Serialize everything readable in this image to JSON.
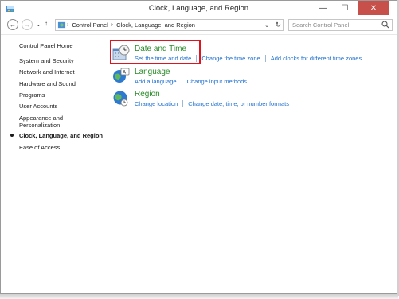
{
  "window": {
    "title": "Clock, Language, and Region",
    "minimize_glyph": "—",
    "maximize_glyph": "☐",
    "close_glyph": "✕"
  },
  "nav": {
    "back_glyph": "←",
    "forward_glyph": "→",
    "history_glyph": "⌄",
    "up_glyph": "↑",
    "address": {
      "separator": "›",
      "segments": [
        "Control Panel",
        "Clock, Language, and Region"
      ],
      "dropdown_glyph": "⌄",
      "refresh_glyph": "↻"
    },
    "search_placeholder": "Search Control Panel"
  },
  "sidebar": {
    "home": "Control Panel Home",
    "items": [
      "System and Security",
      "Network and Internet",
      "Hardware and Sound",
      "Programs",
      "User Accounts",
      "Appearance and",
      "Personalization",
      "Clock, Language, and Region",
      "Ease of Access"
    ]
  },
  "categories": [
    {
      "title": "Date and Time",
      "icon": "date-time-icon",
      "links": [
        "Set the time and date",
        "Change the time zone",
        "Add clocks for different time zones"
      ]
    },
    {
      "title": "Language",
      "icon": "language-icon",
      "links": [
        "Add a language",
        "Change input methods"
      ]
    },
    {
      "title": "Region",
      "icon": "region-globe-icon",
      "links": [
        "Change location",
        "Change date, time, or number formats"
      ]
    }
  ],
  "colors": {
    "link": "#1e6fcf",
    "category_title": "#2a8a2a",
    "highlight": "#e0141e",
    "close_button": "#c7504a"
  }
}
